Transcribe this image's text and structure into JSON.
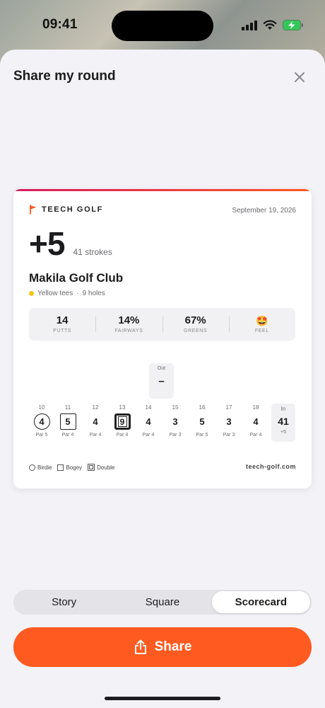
{
  "status_bar": {
    "time": "09:41"
  },
  "sheet": {
    "title": "Share my round"
  },
  "card": {
    "brand": "TEECH GOLF",
    "date": "September 19, 2026",
    "score_to_par": "+5",
    "strokes": "41 strokes",
    "club": "Makila Golf Club",
    "tees": "Yellow tees",
    "separator": "·",
    "holes_played": "9 holes",
    "stats": [
      {
        "value": "14",
        "label": "PUTTS"
      },
      {
        "value": "14%",
        "label": "FAIRWAYS"
      },
      {
        "value": "67%",
        "label": "GREENS"
      },
      {
        "value": "🤩",
        "label": "FEEL"
      }
    ],
    "out": {
      "label": "Out",
      "value": "–"
    },
    "holes": [
      {
        "number": "10",
        "score": "4",
        "par": "Par 5",
        "mark": "birdie"
      },
      {
        "number": "11",
        "score": "5",
        "par": "Par 4",
        "mark": "bogey"
      },
      {
        "number": "12",
        "score": "4",
        "par": "Par 4",
        "mark": "none"
      },
      {
        "number": "13",
        "score": "9",
        "par": "Par 4",
        "mark": "double"
      },
      {
        "number": "14",
        "score": "4",
        "par": "Par 4",
        "mark": "none"
      },
      {
        "number": "15",
        "score": "3",
        "par": "Par 3",
        "mark": "none"
      },
      {
        "number": "16",
        "score": "5",
        "par": "Par 5",
        "mark": "none"
      },
      {
        "number": "17",
        "score": "3",
        "par": "Par 3",
        "mark": "none"
      },
      {
        "number": "18",
        "score": "4",
        "par": "Par 4",
        "mark": "none"
      }
    ],
    "in": {
      "label": "In",
      "value": "41",
      "relative": "+5"
    },
    "legend": {
      "birdie": "Birdie",
      "bogey": "Bogey",
      "double": "Double"
    },
    "website": "teech-golf.com"
  },
  "tabs": [
    {
      "label": "Story",
      "active": false
    },
    {
      "label": "Square",
      "active": false
    },
    {
      "label": "Scorecard",
      "active": true
    }
  ],
  "share_button": {
    "label": "Share"
  },
  "colors": {
    "accent": "#ff5a1f",
    "card_accent_start": "#d81b60",
    "card_accent_end": "#ff5722",
    "tee_yellow": "#f5c518",
    "battery_green": "#34c759"
  }
}
